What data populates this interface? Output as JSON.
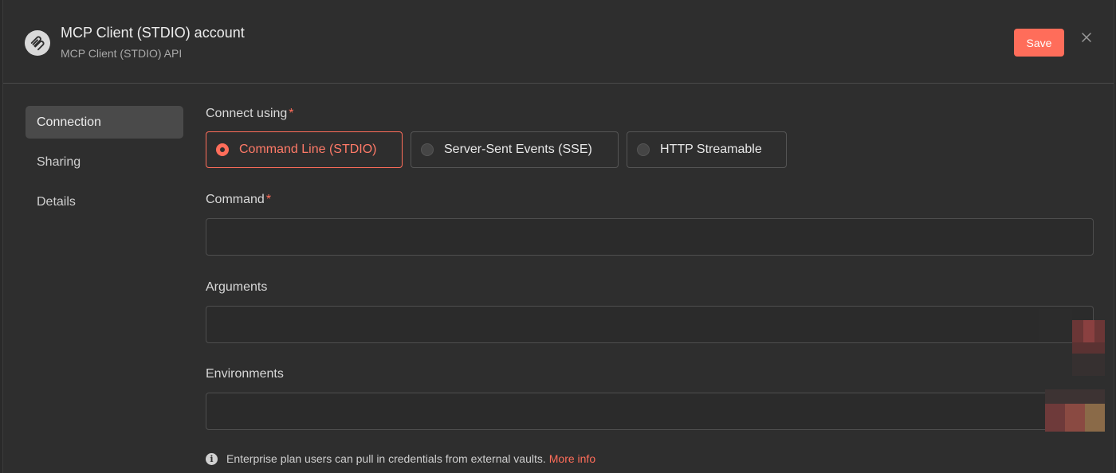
{
  "header": {
    "title": "MCP Client (STDIO) account",
    "subtitle": "MCP Client (STDIO) API",
    "save_label": "Save"
  },
  "sidebar": {
    "items": [
      {
        "label": "Connection",
        "active": true
      },
      {
        "label": "Sharing",
        "active": false
      },
      {
        "label": "Details",
        "active": false
      }
    ]
  },
  "form": {
    "connect_label": "Connect using",
    "required_mark": "*",
    "options": [
      {
        "label": "Command Line (STDIO)",
        "selected": true
      },
      {
        "label": "Server-Sent Events (SSE)",
        "selected": false
      },
      {
        "label": "HTTP Streamable",
        "selected": false
      }
    ],
    "command_label": "Command",
    "command_value": "",
    "arguments_label": "Arguments",
    "arguments_value": "",
    "environments_label": "Environments",
    "environments_value": ""
  },
  "info": {
    "text": "Enterprise plan users can pull in credentials from external vaults.",
    "link_label": "More info"
  },
  "colors": {
    "accent": "#ff6d5a",
    "background": "#2e2e2e"
  }
}
